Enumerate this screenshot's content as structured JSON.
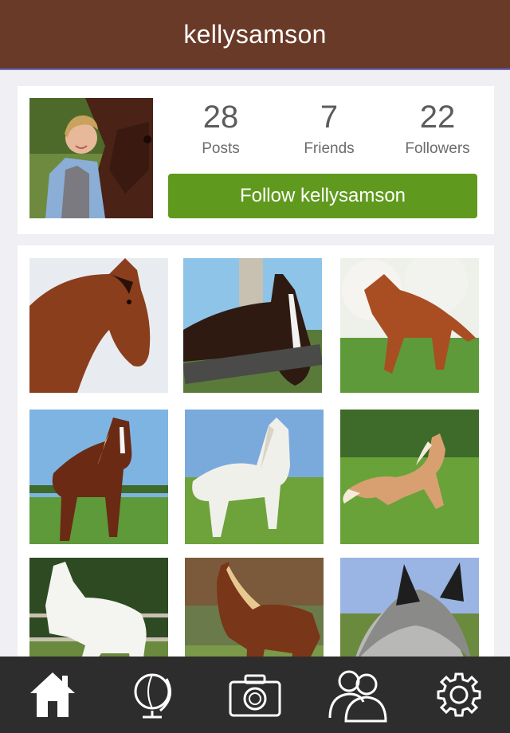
{
  "header": {
    "title": "kellysamson"
  },
  "profile": {
    "avatar_alt": "profile photo",
    "stats": [
      {
        "value": "28",
        "label": "Posts"
      },
      {
        "value": "7",
        "label": "Friends"
      },
      {
        "value": "22",
        "label": "Followers"
      }
    ],
    "follow_label": "Follow kellysamson"
  },
  "grid": {
    "photos": [
      {
        "subject": "bay horse head"
      },
      {
        "subject": "dark bay horse with blaze at fence"
      },
      {
        "subject": "chestnut horse running under blossom tree"
      },
      {
        "subject": "chestnut horse with flaxen mane on lead"
      },
      {
        "subject": "white horse in pasture"
      },
      {
        "subject": "palomino horse galloping"
      },
      {
        "subject": "white horse trotting"
      },
      {
        "subject": "chestnut horse with flaxen mane"
      },
      {
        "subject": "grey horse with long forelock close-up"
      }
    ]
  },
  "tabbar": {
    "items": [
      {
        "name": "home",
        "active": true
      },
      {
        "name": "explore"
      },
      {
        "name": "camera"
      },
      {
        "name": "friends"
      },
      {
        "name": "settings"
      }
    ]
  },
  "colors": {
    "header_bg": "#6a3a28",
    "follow_button": "#5f9a1e",
    "tabbar_bg": "#2d2d2d",
    "page_bg": "#efeff4"
  }
}
